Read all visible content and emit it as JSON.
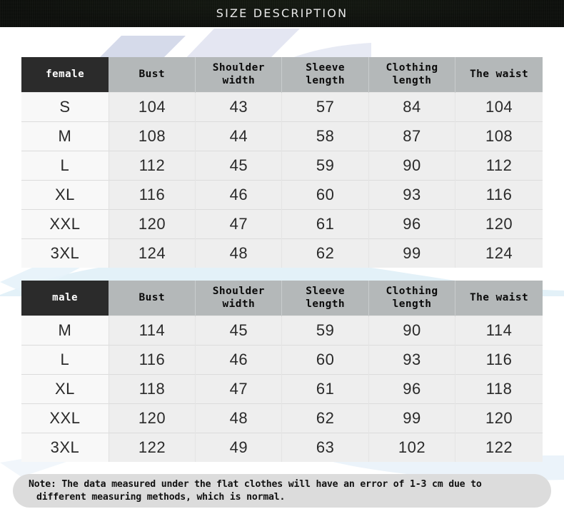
{
  "banner": {
    "title": "SIZE DESCRIPTION"
  },
  "colors": {
    "banner_bg": "#0d0f0c",
    "header_gray": "#b4b8b9",
    "gender_cell_bg": "#2b2b2b",
    "row_bg": "#eeeeee",
    "size_col_bg": "#f8f8f8",
    "note_bg": "#dcdcdc",
    "text_dark": "#2a2a2a"
  },
  "tables": [
    {
      "id": "female",
      "gender_label": "female",
      "columns": [
        "Bust",
        "Shoulder width",
        "Sleeve length",
        "Clothing length",
        "The waist"
      ],
      "columns_wrapped": [
        [
          "Bust"
        ],
        [
          "Shoulder",
          "width"
        ],
        [
          "Sleeve",
          "length"
        ],
        [
          "Clothing",
          "length"
        ],
        [
          "The waist"
        ]
      ],
      "rows": [
        {
          "size": "S",
          "bust": "104",
          "shoulder_width": "43",
          "sleeve_length": "57",
          "clothing_length": "84",
          "the_waist": "104"
        },
        {
          "size": "M",
          "bust": "108",
          "shoulder_width": "44",
          "sleeve_length": "58",
          "clothing_length": "87",
          "the_waist": "108"
        },
        {
          "size": "L",
          "bust": "112",
          "shoulder_width": "45",
          "sleeve_length": "59",
          "clothing_length": "90",
          "the_waist": "112"
        },
        {
          "size": "XL",
          "bust": "116",
          "shoulder_width": "46",
          "sleeve_length": "60",
          "clothing_length": "93",
          "the_waist": "116"
        },
        {
          "size": "XXL",
          "bust": "120",
          "shoulder_width": "47",
          "sleeve_length": "61",
          "clothing_length": "96",
          "the_waist": "120"
        },
        {
          "size": "3XL",
          "bust": "124",
          "shoulder_width": "48",
          "sleeve_length": "62",
          "clothing_length": "99",
          "the_waist": "124"
        }
      ]
    },
    {
      "id": "male",
      "gender_label": "male",
      "columns": [
        "Bust",
        "Shoulder width",
        "Sleeve length",
        "Clothing length",
        "The waist"
      ],
      "columns_wrapped": [
        [
          "Bust"
        ],
        [
          "Shoulder",
          "width"
        ],
        [
          "Sleeve",
          "length"
        ],
        [
          "Clothing",
          "length"
        ],
        [
          "The waist"
        ]
      ],
      "rows": [
        {
          "size": "M",
          "bust": "114",
          "shoulder_width": "45",
          "sleeve_length": "59",
          "clothing_length": "90",
          "the_waist": "114"
        },
        {
          "size": "L",
          "bust": "116",
          "shoulder_width": "46",
          "sleeve_length": "60",
          "clothing_length": "93",
          "the_waist": "116"
        },
        {
          "size": "XL",
          "bust": "118",
          "shoulder_width": "47",
          "sleeve_length": "61",
          "clothing_length": "96",
          "the_waist": "118"
        },
        {
          "size": "XXL",
          "bust": "120",
          "shoulder_width": "48",
          "sleeve_length": "62",
          "clothing_length": "99",
          "the_waist": "120"
        },
        {
          "size": "3XL",
          "bust": "122",
          "shoulder_width": "49",
          "sleeve_length": "63",
          "clothing_length": "102",
          "the_waist": "122"
        }
      ]
    }
  ],
  "note": {
    "line1": "Note: The data measured under the flat clothes will have an error of 1-3 cm due to",
    "line2": "different measuring methods, which is normal."
  }
}
